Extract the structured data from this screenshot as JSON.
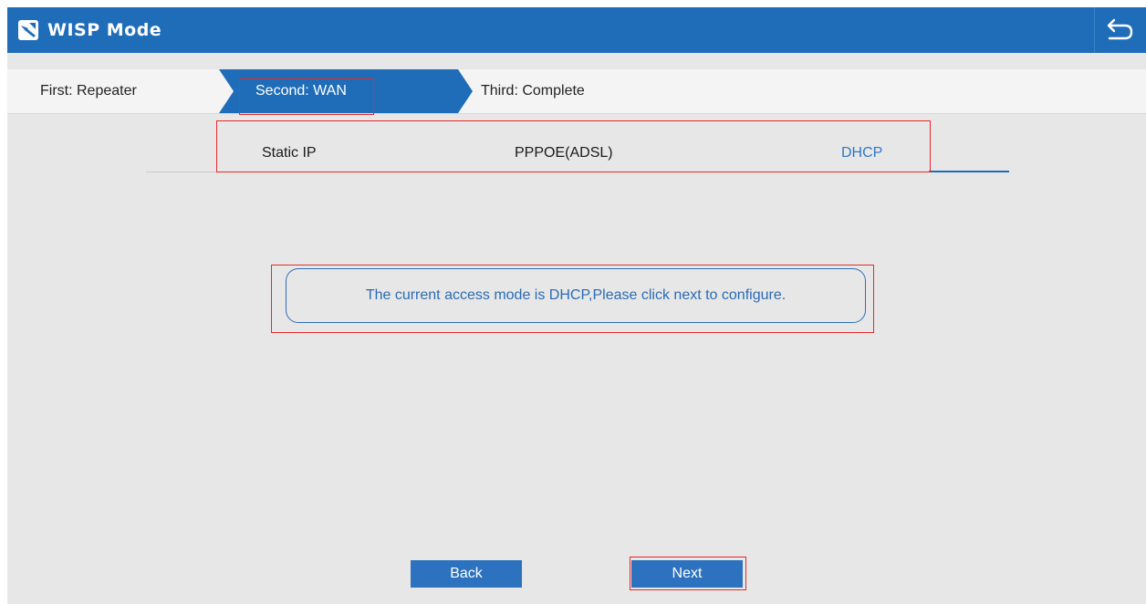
{
  "header": {
    "title": "WISP Mode",
    "app_icon": "wisp-app-icon",
    "back_icon": "return-arrow-icon",
    "background_color": "#1f6db8"
  },
  "steps": {
    "items": [
      {
        "label": "First: Repeater",
        "state": "done"
      },
      {
        "label": "Second: WAN",
        "state": "active"
      },
      {
        "label": "Third: Complete",
        "state": "pending"
      }
    ],
    "active_color": "#1f6db8"
  },
  "wan_tabs": {
    "items": [
      {
        "label": "Static IP",
        "selected": false
      },
      {
        "label": "PPPOE(ADSL)",
        "selected": false
      },
      {
        "label": "DHCP",
        "selected": true
      }
    ],
    "selected_color": "#2f78c4"
  },
  "message": {
    "text": "The current access mode is DHCP,Please click next to configure."
  },
  "footer": {
    "back_label": "Back",
    "next_label": "Next"
  },
  "highlight_color": "#e52a2a"
}
